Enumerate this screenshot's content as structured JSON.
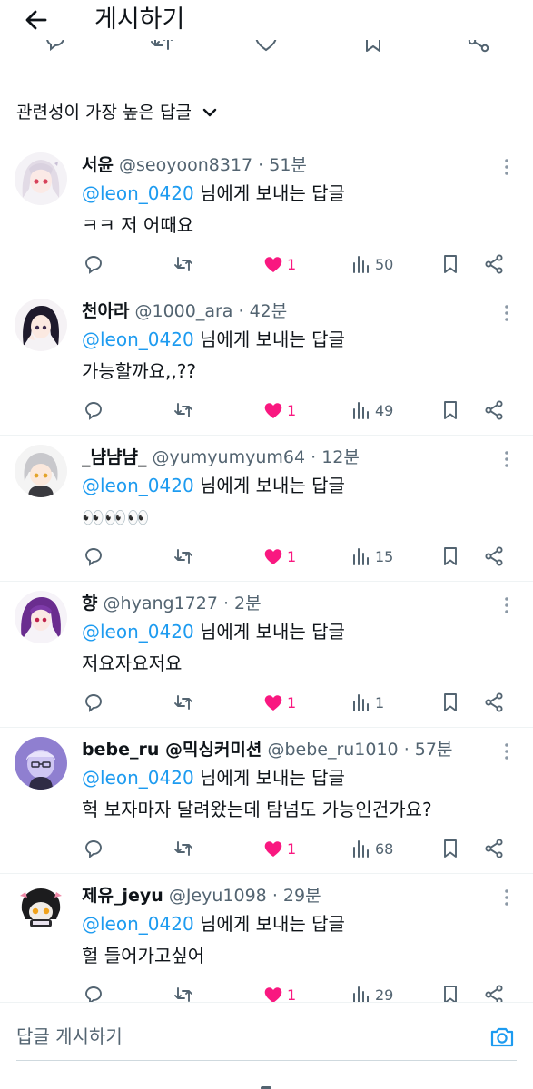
{
  "header": {
    "title": "게시하기"
  },
  "sort": {
    "label": "관련성이 가장 높은 답글"
  },
  "replies": [
    {
      "name": "서윤",
      "handle": "@seoyoon8317",
      "time": "· 51분",
      "mention": "@leon_0420",
      "mention_suffix": " 님에게 보내는 답글",
      "text": "ㅋㅋ 저 어때요",
      "likes": "1",
      "views": "50"
    },
    {
      "name": "천아라",
      "handle": "@1000_ara",
      "time": "· 42분",
      "mention": "@leon_0420",
      "mention_suffix": " 님에게 보내는 답글",
      "text": "가능할까요,,??",
      "likes": "1",
      "views": "49"
    },
    {
      "name": "_냠냠냠_",
      "handle": "@yumyumyum64",
      "time": "· 12분",
      "mention": "@leon_0420",
      "mention_suffix": " 님에게 보내는 답글",
      "text": "👀👀👀",
      "likes": "1",
      "views": "15"
    },
    {
      "name": "향",
      "handle": "@hyang1727",
      "time": "· 2분",
      "mention": "@leon_0420",
      "mention_suffix": " 님에게 보내는 답글",
      "text": "저요자요저요",
      "likes": "1",
      "views": "1"
    },
    {
      "name": "bebe_ru @믹싱커미션",
      "handle": "@bebe_ru1010",
      "time": "· 57분",
      "mention": "@leon_0420",
      "mention_suffix": " 님에게 보내는 답글",
      "text": "헉 보자마자 달려왔는데 탐넘도 가능인건가요?",
      "likes": "1",
      "views": "68"
    },
    {
      "name": "제유_jeyu",
      "handle": "@Jeyu1098",
      "time": "· 29분",
      "mention": "@leon_0420",
      "mention_suffix": " 님에게 보내는 답글",
      "text": "헐 들어가고싶어",
      "likes": "1",
      "views": "29"
    }
  ],
  "composer": {
    "placeholder": "답글 게시하기"
  },
  "colors": {
    "accent": "#1d9bf0",
    "like": "#f91880",
    "muted": "#536471",
    "text": "#0f1419",
    "divider": "#eff3f4"
  },
  "icons": {
    "back": "arrow-left-icon",
    "sort": "chevron-down-icon",
    "reply": "speech-bubble-icon",
    "retweet": "retweet-icon",
    "like": "heart-filled-icon",
    "views": "bar-chart-icon",
    "bookmark": "bookmark-icon",
    "share": "share-nodes-icon",
    "more": "vertical-dots-icon",
    "camera": "camera-icon"
  }
}
